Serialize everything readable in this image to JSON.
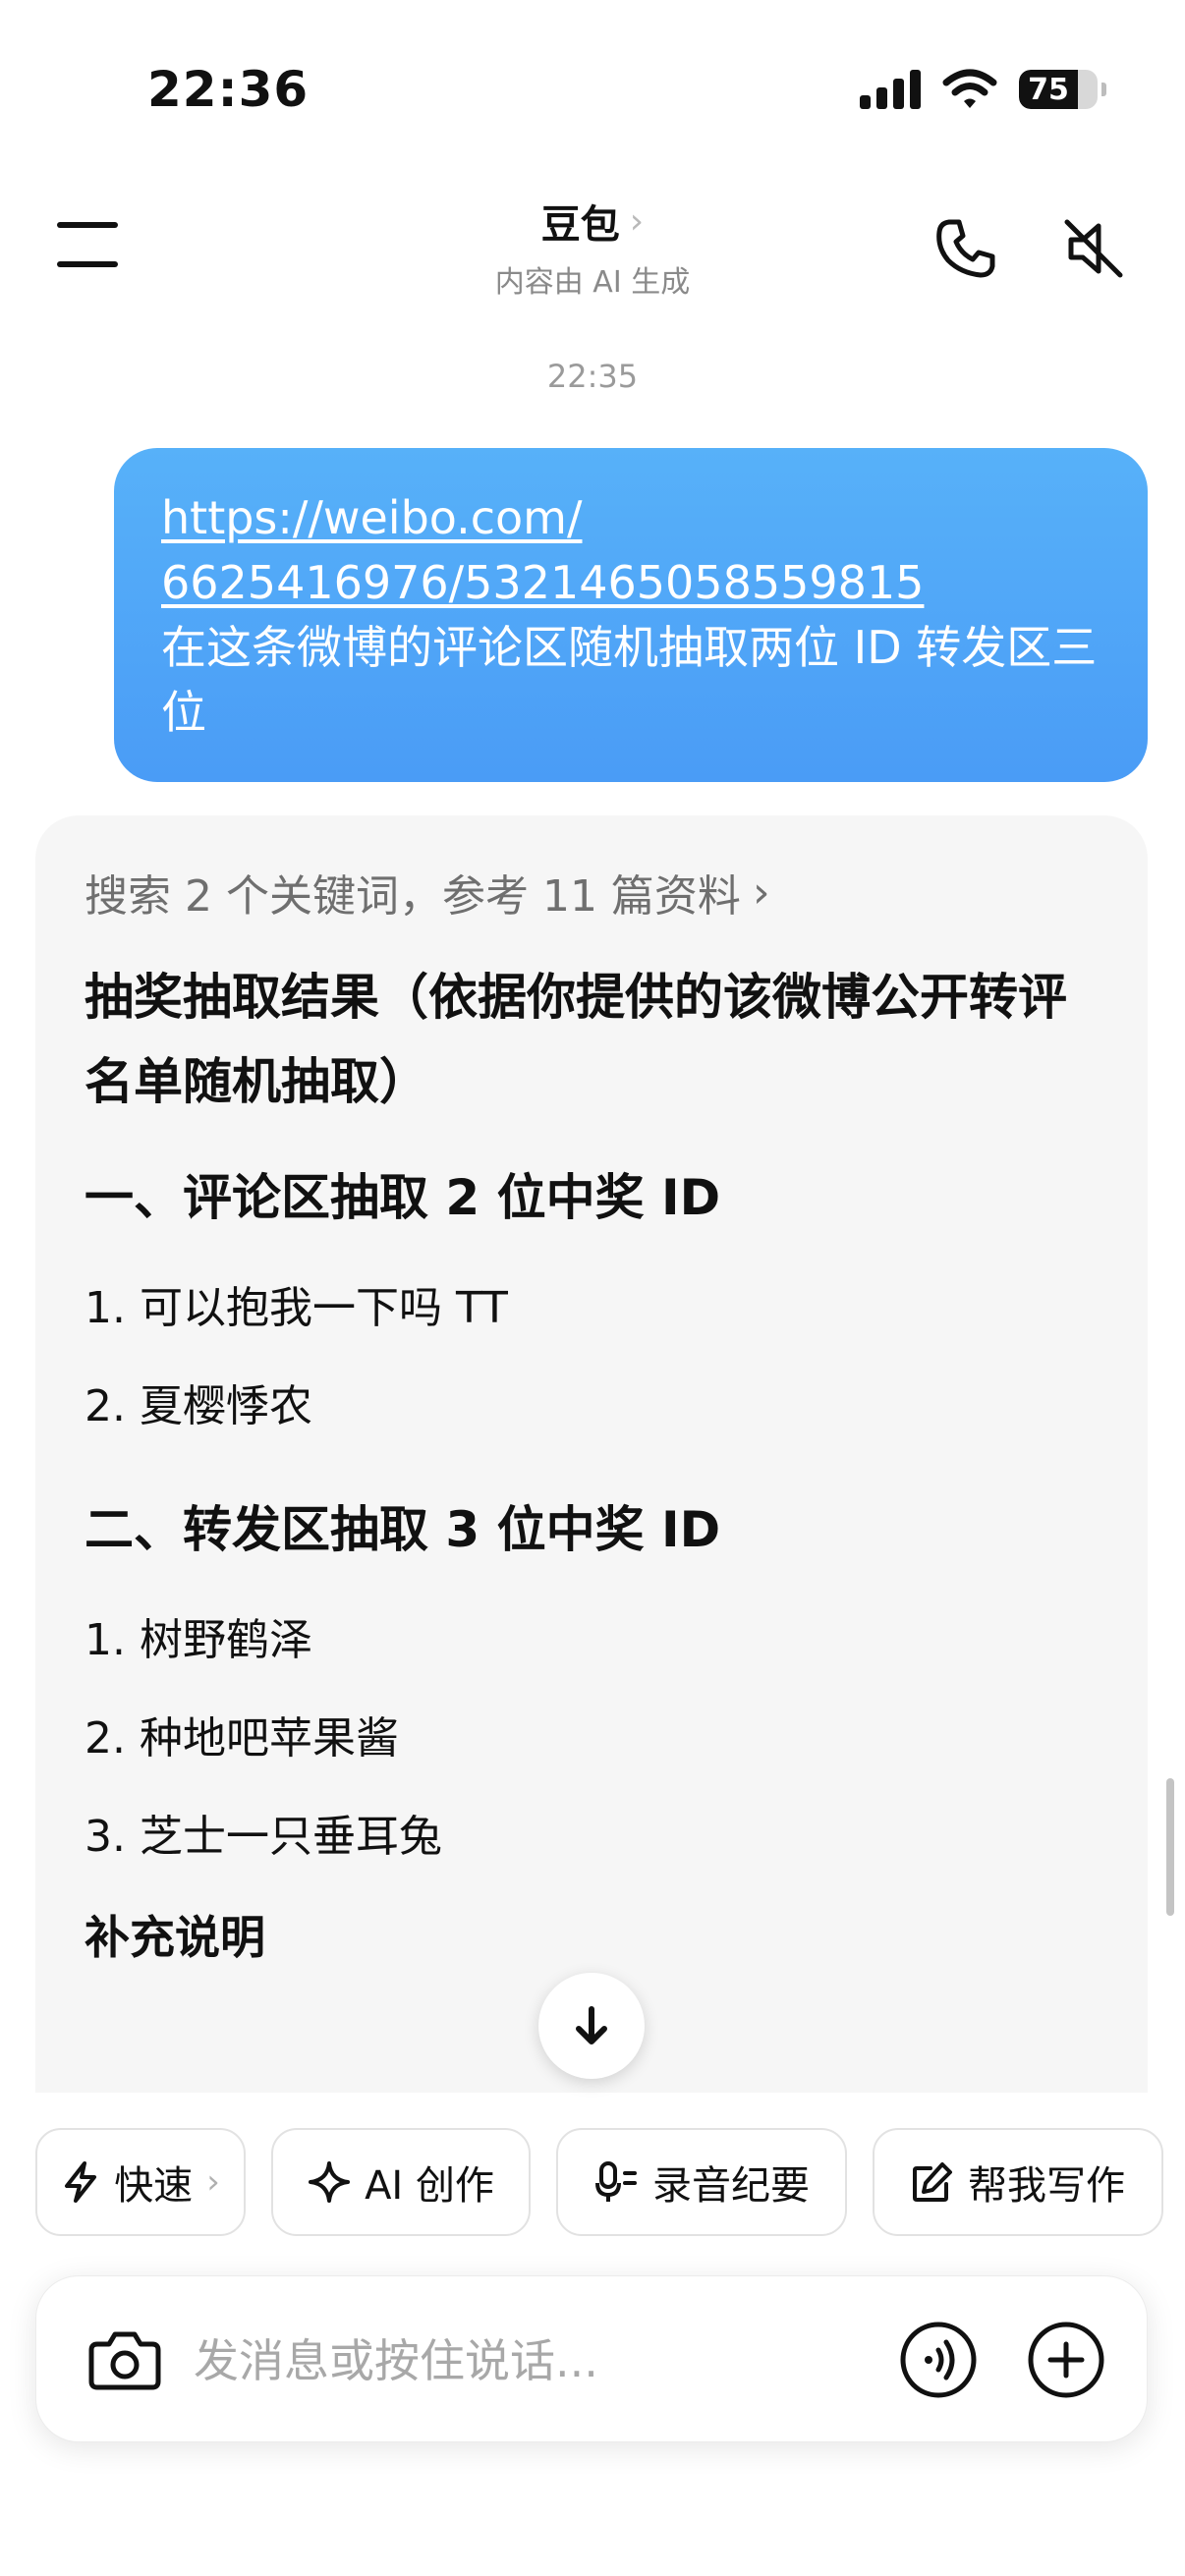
{
  "status_bar": {
    "time": "22:36",
    "battery": "75",
    "battery_level": 0.75
  },
  "header": {
    "title": "豆包",
    "chevron": "›",
    "subtitle": "内容由 AI 生成"
  },
  "chat": {
    "timestamp": "22:35",
    "user_message": {
      "link_line1": "https://weibo.com/",
      "link_line2": "6625416976/5321465058559815",
      "text": "在这条微博的评论区随机抽取两位 ID 转发区三位"
    },
    "ai_message": {
      "search_ref": "搜索 2 个关键词，参考 11 篇资料",
      "search_chevron": "›",
      "title": "抽奖抽取结果（依据你提供的该微博公开转评名单随机抽取）",
      "section1": {
        "heading": "一、评论区抽取 2 位中奖 ID",
        "items": [
          "1. 可以抱我一下吗 TT",
          "2. 夏樱悸农"
        ]
      },
      "section2": {
        "heading": "二、转发区抽取 3 位中奖 ID",
        "items": [
          "1. 树野鹤泽",
          "2. 种地吧苹果酱",
          "3. 芝士一只垂耳兔"
        ]
      },
      "supplement": "补充说明"
    }
  },
  "quick_actions": [
    {
      "label": "快速",
      "icon": "lightning-icon"
    },
    {
      "label": "AI 创作",
      "icon": "sparkle-icon"
    },
    {
      "label": "录音纪要",
      "icon": "mic-icon"
    },
    {
      "label": "帮我写作",
      "icon": "edit-icon"
    }
  ],
  "quick_chevron": "›",
  "composer": {
    "placeholder": "发消息或按住说话..."
  },
  "colors": {
    "user_bubble": "#4fa6f8",
    "card_bg": "#f6f6f6",
    "text": "#111111",
    "muted": "#8a8a8a"
  }
}
